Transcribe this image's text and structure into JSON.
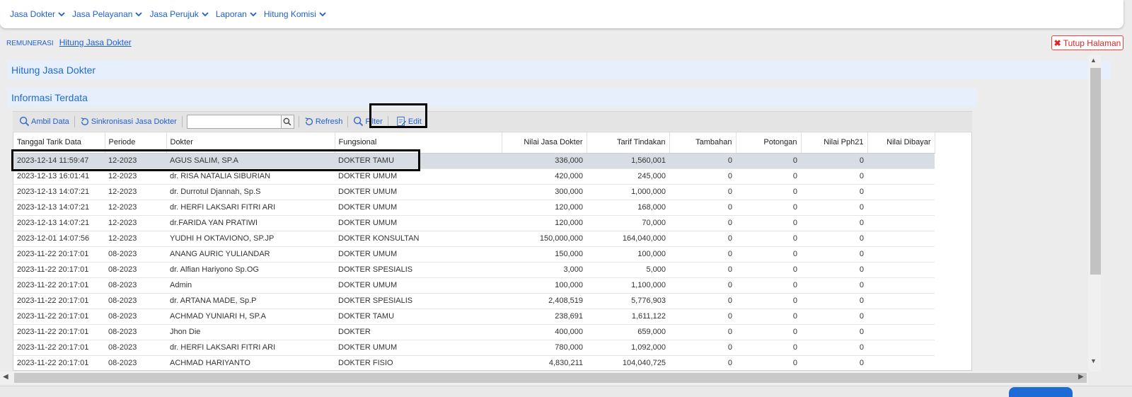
{
  "nav": {
    "items": [
      {
        "label": "Jasa Dokter"
      },
      {
        "label": "Jasa Pelayanan"
      },
      {
        "label": "Jasa Perujuk"
      },
      {
        "label": "Laporan"
      },
      {
        "label": "Hitung Komisi"
      }
    ]
  },
  "breadcrumb": {
    "root": "REMUNERASI",
    "current": "Hitung Jasa Dokter"
  },
  "close_button": {
    "label": "Tutup Halaman",
    "icon": "close-x-icon",
    "color": "#e02424"
  },
  "panels": {
    "main_title": "Hitung Jasa Dokter",
    "sub_title": "Informasi Terdata"
  },
  "toolbar": {
    "ambil_data": "Ambil Data",
    "sinkronisasi": "Sinkronisasi Jasa Dokter",
    "search_value": "",
    "refresh": "Refresh",
    "filter": "Filter",
    "edit": "Edit"
  },
  "table": {
    "columns": [
      "Tanggal Tarik Data",
      "Periode",
      "Dokter",
      "Fungsional",
      "Nilai Jasa Dokter",
      "Tarif Tindakan",
      "Tambahan",
      "Potongan",
      "Nilai Pph21",
      "Nilai Dibayar"
    ],
    "selected_row": 0,
    "rows": [
      [
        "2023-12-14 11:59:47",
        "12-2023",
        "AGUS SALIM, SP.A",
        "DOKTER TAMU",
        "336,000",
        "1,560,001",
        "0",
        "0",
        "0",
        ""
      ],
      [
        "2023-12-13 16:01:41",
        "12-2023",
        "dr. RISA NATALIA SIBURIAN",
        "DOKTER UMUM",
        "420,000",
        "245,000",
        "0",
        "0",
        "0",
        ""
      ],
      [
        "2023-12-13 14:07:21",
        "12-2023",
        "dr. Durrotul Djannah, Sp.S",
        "DOKTER UMUM",
        "300,000",
        "1,000,000",
        "0",
        "0",
        "0",
        ""
      ],
      [
        "2023-12-13 14:07:21",
        "12-2023",
        "dr. HERFI LAKSARI FITRI ARI",
        "DOKTER UMUM",
        "120,000",
        "168,000",
        "0",
        "0",
        "0",
        ""
      ],
      [
        "2023-12-13 14:07:21",
        "12-2023",
        "dr.FARIDA YAN PRATIWI",
        "DOKTER UMUM",
        "120,000",
        "70,000",
        "0",
        "0",
        "0",
        ""
      ],
      [
        "2023-12-01 14:07:56",
        "12-2023",
        "YUDHI H OKTAVIONO, SP.JP",
        "DOKTER KONSULTAN",
        "150,000,000",
        "164,040,000",
        "0",
        "0",
        "0",
        ""
      ],
      [
        "2023-11-22 20:17:01",
        "08-2023",
        "ANANG AURIC YULIANDAR",
        "DOKTER UMUM",
        "150,000",
        "100,000",
        "0",
        "0",
        "0",
        ""
      ],
      [
        "2023-11-22 20:17:01",
        "08-2023",
        "dr. Alfian Hariyono Sp.OG",
        "DOKTER SPESIALIS",
        "3,000",
        "5,000",
        "0",
        "0",
        "0",
        ""
      ],
      [
        "2023-11-22 20:17:01",
        "08-2023",
        "Admin",
        "DOKTER UMUM",
        "100,000",
        "1,100,000",
        "0",
        "0",
        "0",
        ""
      ],
      [
        "2023-11-22 20:17:01",
        "08-2023",
        "dr. ARTANA MADE, Sp.P",
        "DOKTER SPESIALIS",
        "2,408,519",
        "5,776,903",
        "0",
        "0",
        "0",
        ""
      ],
      [
        "2023-11-22 20:17:01",
        "08-2023",
        "ACHMAD YUNIARI H, SP.A",
        "DOKTER TAMU",
        "238,691",
        "1,611,122",
        "0",
        "0",
        "0",
        ""
      ],
      [
        "2023-11-22 20:17:01",
        "08-2023",
        "Jhon Die",
        "DOKTER",
        "400,000",
        "659,000",
        "0",
        "0",
        "0",
        ""
      ],
      [
        "2023-11-22 20:17:01",
        "08-2023",
        "dr. HERFI LAKSARI FITRI ARI",
        "DOKTER UMUM",
        "780,000",
        "1,092,000",
        "0",
        "0",
        "0",
        ""
      ],
      [
        "2023-11-22 20:17:01",
        "08-2023",
        "ACHMAD HARIYANTO",
        "DOKTER FISIO",
        "4,830,211",
        "104,040,725",
        "0",
        "0",
        "0",
        ""
      ]
    ]
  },
  "colors": {
    "accent": "#1e5fd6",
    "panel_bg": "#e6effb",
    "selected_row": "#d8dde3"
  }
}
